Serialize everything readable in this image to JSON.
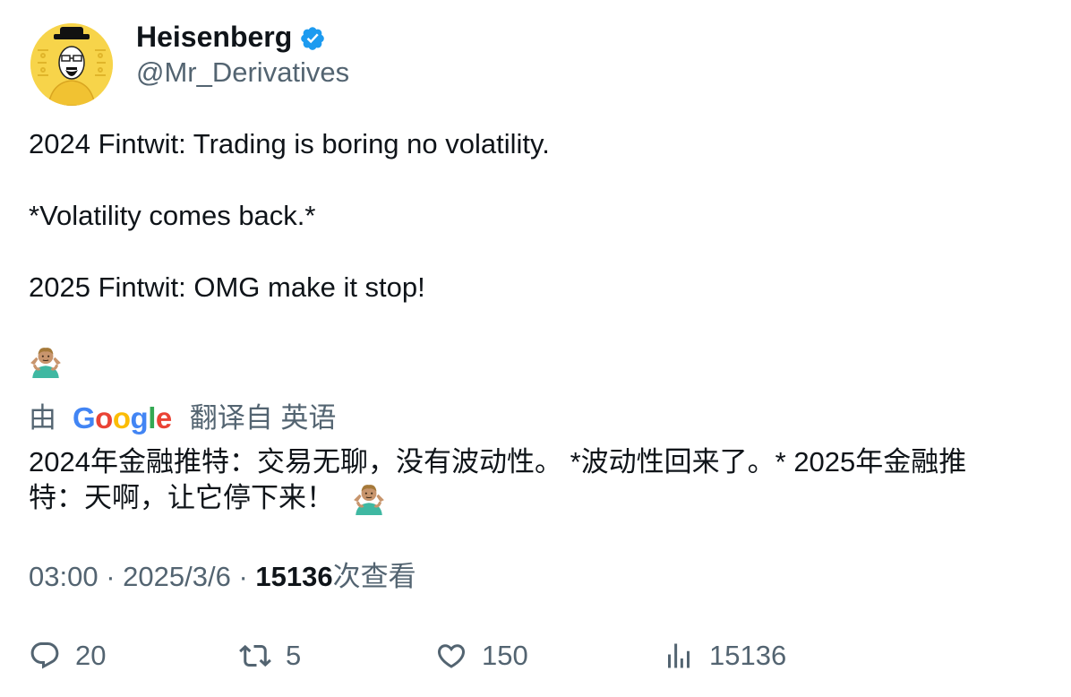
{
  "author": {
    "display_name": "Heisenberg",
    "handle": "@Mr_Derivatives",
    "verified": true,
    "avatar_icon": "heisenberg-avatar-icon"
  },
  "tweet": {
    "lines": [
      "2024 Fintwit: Trading is boring no volatility.",
      "*Volatility comes back.*",
      "2025 Fintwit: OMG make it stop!"
    ],
    "emoji": "person-shrugging-emoji"
  },
  "translation": {
    "by_label": "由",
    "provider": "Google",
    "from_label": "翻译自 英语",
    "text_line1": "2024年金融推特：交易无聊，没有波动性。 *波动性回来了。* 2025年金融推",
    "text_line2": "特：天啊，让它停下来！"
  },
  "meta": {
    "time": "03:00",
    "separator": "·",
    "date": "2025/3/6",
    "views_count": "15136",
    "views_label": "次查看"
  },
  "actions": {
    "replies": "20",
    "retweets": "5",
    "likes": "150",
    "views": "15136"
  },
  "colors": {
    "text_primary": "#0f1419",
    "text_secondary": "#536471",
    "verified_blue": "#1d9bf0",
    "avatar_yellow": "#f7d44a"
  }
}
